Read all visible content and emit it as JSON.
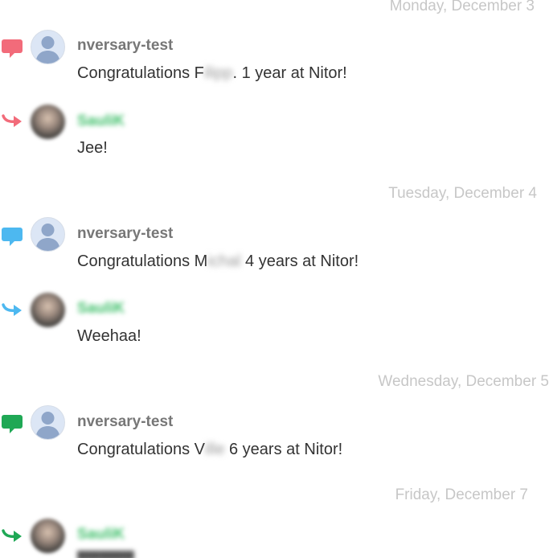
{
  "dates": {
    "d1": "Monday, December 3",
    "d2": "Tuesday, December 4",
    "d3": "Wednesday, December 5",
    "d4": "Friday, December 7"
  },
  "colors": {
    "red": "#f26b7a",
    "blue": "#4db8f0",
    "green": "#1fa855",
    "muted_date": "#c7c7c7",
    "sender": "#777777",
    "blurred_sender": "#3fbf6a"
  },
  "messages": [
    {
      "sender": "nversary-test",
      "text_before": "Congratulations F",
      "redacted": "ilipp",
      "text_after": ". 1 year at Nitor!",
      "icon": "speech-bubble-icon",
      "color": "red"
    },
    {
      "sender": "SauliK",
      "text": "Jee!",
      "icon": "reply-arrow-icon",
      "color": "red"
    },
    {
      "sender": "nversary-test",
      "text_before": "Congratulations M",
      "redacted": "ichal",
      "text_after": "4 years at Nitor!",
      "icon": "speech-bubble-icon",
      "color": "blue"
    },
    {
      "sender": "SauliK",
      "text": "Weehaa!",
      "icon": "reply-arrow-icon",
      "color": "blue"
    },
    {
      "sender": "nversary-test",
      "text_before": "Congratulations V",
      "redacted": "ille",
      "text_after": "6 years at Nitor!",
      "icon": "speech-bubble-icon",
      "color": "green"
    },
    {
      "sender": "SauliK",
      "icon": "reply-arrow-icon",
      "color": "green"
    }
  ]
}
